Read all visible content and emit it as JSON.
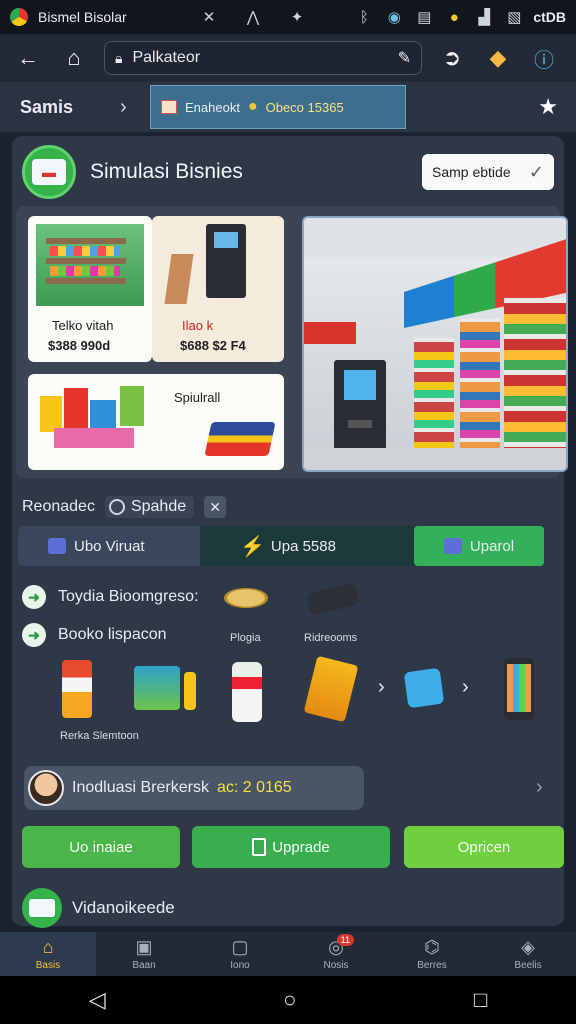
{
  "statusbar": {
    "tab_title": "Bismel Bisolar",
    "right_text": "ctDB",
    "colors": {
      "background": "#11151c"
    }
  },
  "browser": {
    "url": "Palkateor",
    "icons": [
      "back-arrow-icon",
      "home-icon",
      "lock-icon",
      "edit-icon",
      "forward-icon",
      "extension-icon",
      "info-icon"
    ]
  },
  "tabs": {
    "label": "Samis",
    "active_tab": {
      "name": "Enaheokt",
      "coins": "Obeco 15365"
    }
  },
  "header": {
    "title": "Simulasi Bisnies",
    "select_value": "Samp ebtide"
  },
  "gallery": {
    "card1": {
      "caption": "Telko vitah",
      "price": "$388 990d"
    },
    "card2": {
      "caption": "Ilao k",
      "price": "$688 $2 F4"
    },
    "card3": {
      "caption": "Spiulrall"
    }
  },
  "recommendation": {
    "label": "Reonadec",
    "toggle_label": "Spahde"
  },
  "segments": {
    "left": "Ubo Viruat",
    "middle": "Upa 5588",
    "right": "Uparol"
  },
  "features": [
    {
      "label": "Toydia Bioomgreso:"
    },
    {
      "label": "Booko lispacon"
    }
  ],
  "accessories": {
    "label1": "Plogia",
    "label2": "Ridreooms"
  },
  "products": {
    "caption": "Rerka Slemtoon"
  },
  "promo": {
    "text": "Inodluasi Brerkersk",
    "code": "ac: 2 0165"
  },
  "actions": {
    "btn1": "Uo inaiae",
    "btn2": "Upprade",
    "btn3": "Opricen"
  },
  "next_section": {
    "title": "Vidanoikeede"
  },
  "bottom_nav": [
    {
      "label": "Basis",
      "icon": "home-icon",
      "active": true
    },
    {
      "label": "Baan",
      "icon": "briefcase-icon"
    },
    {
      "label": "Iono",
      "icon": "tablet-icon"
    },
    {
      "label": "Nosis",
      "icon": "globe-icon",
      "badge": "11"
    },
    {
      "label": "Berres",
      "icon": "store-icon"
    },
    {
      "label": "Beelis",
      "icon": "cube-icon"
    }
  ],
  "colors": {
    "accent_green": "#3aad4f",
    "panel": "#2f3846",
    "coin": "#f6c92b"
  }
}
